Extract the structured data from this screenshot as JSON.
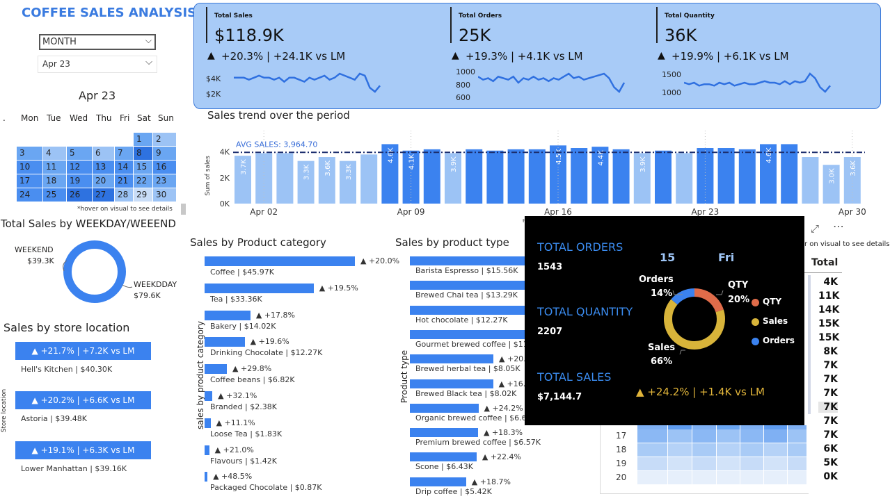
{
  "title": "COFFEE SALES ANALYSIS",
  "filters": {
    "month_label": "MONTH",
    "selected": "Apr 23"
  },
  "calendar": {
    "title": "Apr 23",
    "weekdays": [
      "Mon",
      "Tue",
      "Wed",
      "Thu",
      "Fri",
      "Sat",
      "Sun"
    ],
    "rows": [
      [
        "",
        "",
        "",
        "",
        "",
        "1",
        "2"
      ],
      [
        "3",
        "4",
        "5",
        "6",
        "7",
        "8",
        "9"
      ],
      [
        "10",
        "11",
        "12",
        "13",
        "14",
        "15",
        "16"
      ],
      [
        "17",
        "18",
        "19",
        "20",
        "21",
        "22",
        "23"
      ],
      [
        "24",
        "25",
        "26",
        "27",
        "28",
        "29",
        "30"
      ]
    ],
    "hint": "*hover on visual to see details"
  },
  "kpis": [
    {
      "label": "Total Sales",
      "value": "$118.9K",
      "change": "+20.3% | +24.1K vs LM",
      "ticks": [
        "$4K",
        "$2K"
      ]
    },
    {
      "label": "Total Orders",
      "value": "25K",
      "change": "+19.3% | +4.1K vs LM",
      "ticks": [
        "1000",
        "800",
        "600"
      ]
    },
    {
      "label": "Total Quantity",
      "value": "36K",
      "change": "+19.9% | +6.1K vs LM",
      "ticks": [
        "1500",
        "1000"
      ]
    }
  ],
  "trend": {
    "title": "Sales trend over the period",
    "avg_label": "AVG SALES: 3,964.70",
    "ylabel": "Sum of sales",
    "yticks": [
      "4K",
      "2K",
      "0K"
    ],
    "xticks": [
      "Apr 02",
      "Apr 09",
      "Apr 16",
      "Apr 23",
      "Apr 30"
    ],
    "xlabel_partial": "t"
  },
  "chart_data": {
    "type": "bar",
    "title": "Sales trend over the period",
    "ylabel": "Sum of sales",
    "ylim": [
      0,
      5000
    ],
    "avg": 3964.7,
    "categories": [
      "Apr 01",
      "Apr 02",
      "Apr 03",
      "Apr 04",
      "Apr 05",
      "Apr 06",
      "Apr 07",
      "Apr 08",
      "Apr 09",
      "Apr 10",
      "Apr 11",
      "Apr 12",
      "Apr 13",
      "Apr 14",
      "Apr 15",
      "Apr 16",
      "Apr 17",
      "Apr 18",
      "Apr 19",
      "Apr 20",
      "Apr 21",
      "Apr 22",
      "Apr 23",
      "Apr 24",
      "Apr 25",
      "Apr 26",
      "Apr 27",
      "Apr 28",
      "Apr 29",
      "Apr 30"
    ],
    "values": [
      3700,
      3900,
      3900,
      3300,
      3600,
      3300,
      3800,
      4600,
      4100,
      4200,
      3900,
      4200,
      4100,
      4200,
      4200,
      4500,
      4300,
      4400,
      4200,
      3900,
      4100,
      3900,
      4300,
      4300,
      4200,
      4600,
      4600,
      3600,
      3000,
      3600
    ],
    "data_labels": [
      "3.7K",
      "",
      "",
      "3.3K",
      "3.6K",
      "3.3K",
      "",
      "4.6K",
      "4.1K",
      "",
      "3.9K",
      "",
      "",
      "",
      "",
      "4.5K",
      "",
      "4.4K",
      "",
      "3.9K",
      "",
      "",
      "",
      "",
      "",
      "4.6K",
      "",
      "",
      "3.0K",
      "3.6K"
    ]
  },
  "weekday_weekend": {
    "title": "Total Sales by WEEKDAY/WEEEND",
    "weekend_label": "WEEKEND",
    "weekend_value": "$39.3K",
    "weekday_label": "WEEKDDAY",
    "weekday_value": "$79.6K"
  },
  "store": {
    "title": "Sales by store location",
    "axis": "Store location",
    "items": [
      {
        "change": "▲ +21.7% | +7.2K vs LM",
        "label": "Hell's Kitchen | $40.30K"
      },
      {
        "change": "▲ +20.2% | +6.6K vs LM",
        "label": "Astoria | $39.48K"
      },
      {
        "change": "▲ +19.1% | +6.3K vs LM",
        "label": "Lower Manhattan | $39.16K"
      }
    ]
  },
  "category": {
    "title": "Sales by Product category",
    "axis": "sales by product category",
    "items": [
      {
        "label": "Coffee | $45.97K",
        "change": "▲ +20.0%",
        "value": 45.97
      },
      {
        "label": "Tea | $33.36K",
        "change": "▲ +19.5%",
        "value": 33.36
      },
      {
        "label": "Bakery | $14.02K",
        "change": "▲ +17.8%",
        "value": 14.02
      },
      {
        "label": "Drinking Chocolate | $12.27K",
        "change": "▲ +19.6%",
        "value": 12.27
      },
      {
        "label": "Coffee beans | $6.82K",
        "change": "▲ +29.8%",
        "value": 6.82
      },
      {
        "label": "Branded | $2.38K",
        "change": "▲ +32.1%",
        "value": 2.38
      },
      {
        "label": "Loose Tea | $1.83K",
        "change": "▲ +11.1%",
        "value": 1.83
      },
      {
        "label": "Flavours | $1.42K",
        "change": "▲ +21.0%",
        "value": 1.42
      },
      {
        "label": "Packaged Chocolate | $0.87K",
        "change": "▲ +48.5%",
        "value": 0.87
      }
    ]
  },
  "ptype": {
    "title": "Sales by product type",
    "axis": "Product type",
    "items": [
      {
        "label": "Barista Espresso | $15.56K",
        "change": "",
        "value": 15.56
      },
      {
        "label": "Brewed Chai tea | $13.29K",
        "change": "",
        "value": 13.29
      },
      {
        "label": "Hot chocolate | $12.27K",
        "change": "",
        "value": 12.27
      },
      {
        "label": "Gourmet brewed coffee | $11.",
        "change": "",
        "value": 11.8
      },
      {
        "label": "Brewed herbal tea | $8.05K",
        "change": "▲ +20.5",
        "value": 8.05
      },
      {
        "label": "Brewed Black tea | $8.02K",
        "change": "▲ +16.7",
        "value": 8.02
      },
      {
        "label": "Organic brewed coffee | $6.61",
        "change": "▲ +24.2%",
        "value": 6.61
      },
      {
        "label": "Premium brewed coffee | $6.57K",
        "change": "▲ +18.3%",
        "value": 6.57
      },
      {
        "label": "Scone | $6.43K",
        "change": "▲ +22.4%",
        "value": 6.43
      },
      {
        "label": "Drip coffee | $5.42K",
        "change": "▲ +18.7%",
        "value": 5.42
      }
    ]
  },
  "heatmap": {
    "hint_partial": "r on visual to see details",
    "total_header": "Total",
    "totals": [
      "4K",
      "11K",
      "14K",
      "15K",
      "15K",
      "8K",
      "7K",
      "7K",
      "7K",
      "7K",
      "7K",
      "7K",
      "6K",
      "5K",
      "0K"
    ],
    "hour_labels": [
      "17",
      "18",
      "19",
      "20"
    ]
  },
  "tooltip": {
    "orders_label": "TOTAL ORDERS",
    "orders_value": "1543",
    "qty_label": "TOTAL QUANTITY",
    "qty_value": "2207",
    "sales_label": "TOTAL SALES",
    "sales_value": "$7,144.7",
    "day": "15",
    "weekday": "Fri",
    "change": "▲ +24.2% | +1.4K vs LM",
    "donut": [
      {
        "name": "QTY",
        "pct": "20%",
        "share": 0.2,
        "color": "#e06c4a"
      },
      {
        "name": "Sales",
        "pct": "66%",
        "share": 0.66,
        "color": "#d8b43a"
      },
      {
        "name": "Orders",
        "pct": "14%",
        "share": 0.14,
        "color": "#3b82ef"
      }
    ]
  },
  "colors": {
    "accent": "#3b82ef",
    "light": "#9cc3f5",
    "dark": "#1a2c8c"
  }
}
